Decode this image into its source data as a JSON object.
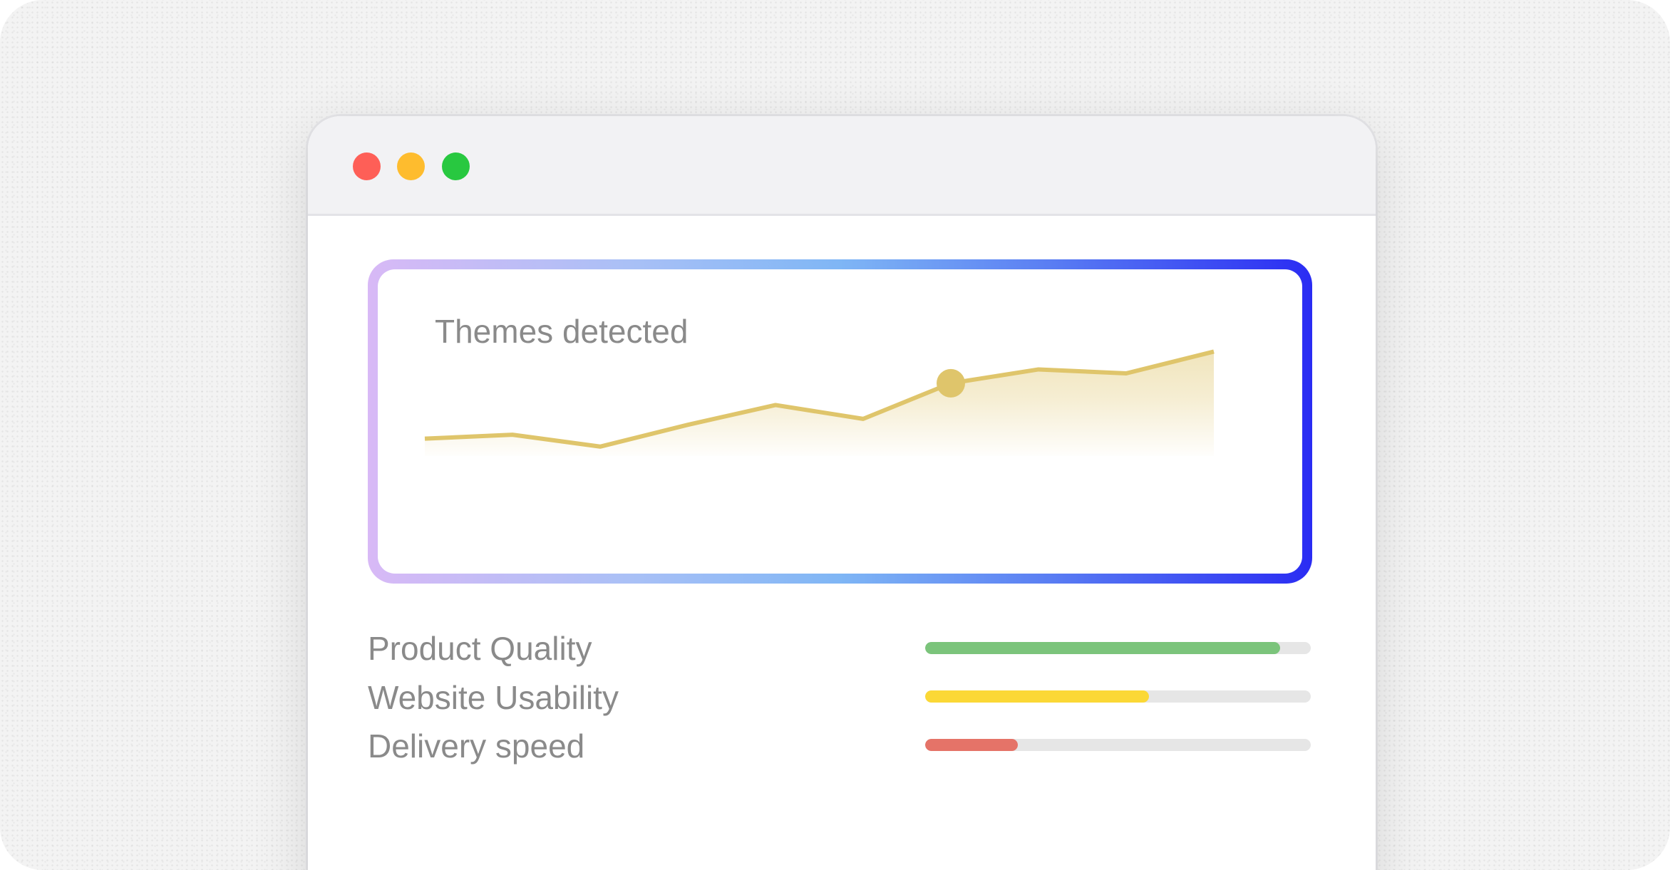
{
  "window": {
    "controls": [
      {
        "name": "close",
        "color": "#fe5f57"
      },
      {
        "name": "minimize",
        "color": "#febc2e"
      },
      {
        "name": "maximize",
        "color": "#28c840"
      }
    ]
  },
  "card": {
    "title": "Themes detected"
  },
  "chart_data": {
    "type": "area",
    "title": "Themes detected",
    "x": [
      1,
      2,
      3,
      4,
      5,
      6,
      7,
      8,
      9,
      10
    ],
    "values": [
      10,
      12,
      6,
      17,
      27,
      20,
      38,
      45,
      43,
      54
    ],
    "ylim": [
      -2,
      70
    ],
    "highlight_index": 6,
    "line_color": "#dfc56b",
    "grid": false,
    "legend": "none"
  },
  "metrics": [
    {
      "label": "Product Quality",
      "level": 0.92,
      "color": "#7bc47b"
    },
    {
      "label": "Website Usability",
      "level": 0.58,
      "color": "#fbd836"
    },
    {
      "label": "Delivery speed",
      "level": 0.24,
      "color": "#e57368"
    }
  ]
}
